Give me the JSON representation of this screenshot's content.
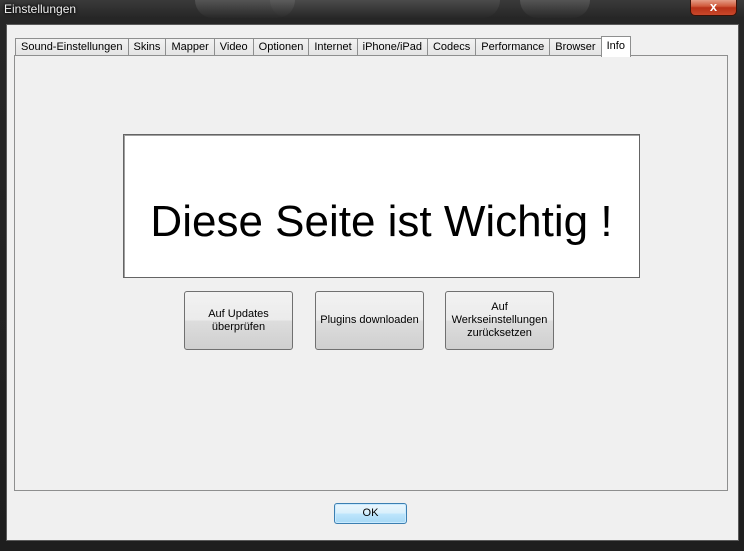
{
  "window": {
    "title": "Einstellungen",
    "close_label": "x"
  },
  "tabs": [
    {
      "label": "Sound-Einstellungen",
      "active": false
    },
    {
      "label": "Skins",
      "active": false
    },
    {
      "label": "Mapper",
      "active": false
    },
    {
      "label": "Video",
      "active": false
    },
    {
      "label": "Optionen",
      "active": false
    },
    {
      "label": "Internet",
      "active": false
    },
    {
      "label": "iPhone/iPad",
      "active": false
    },
    {
      "label": "Codecs",
      "active": false
    },
    {
      "label": "Performance",
      "active": false
    },
    {
      "label": "Browser",
      "active": false
    },
    {
      "label": "Info",
      "active": true
    }
  ],
  "info_panel": {
    "banner_text": "Diese Seite ist Wichtig !",
    "buttons": {
      "check_updates": "Auf Updates überprüfen",
      "download_plugins": "Plugins downloaden",
      "factory_reset": "Auf Werkseinstellungen zurücksetzen"
    }
  },
  "footer": {
    "ok_label": "OK"
  },
  "colors": {
    "title_bar": "#262626",
    "close_button": "#c9482b",
    "dialog_background": "#f0f0f0",
    "ok_button": "#bee6fd"
  }
}
